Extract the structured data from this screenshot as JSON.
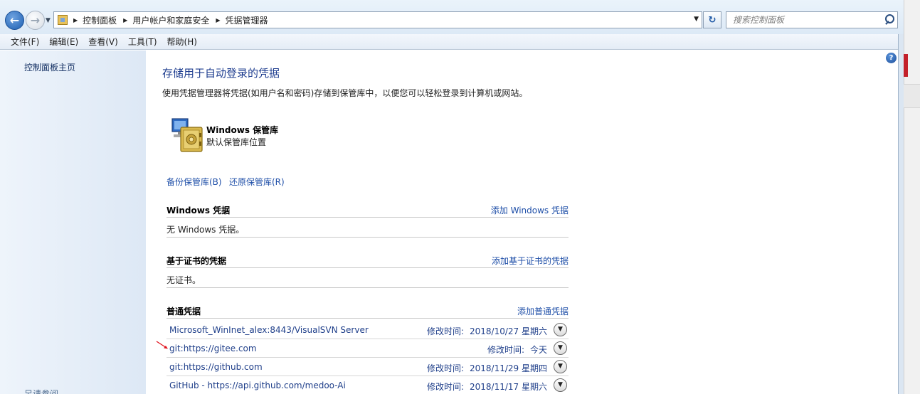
{
  "address_bar": {
    "crumbs": [
      "控制面板",
      "用户帐户和家庭安全",
      "凭据管理器"
    ],
    "search_placeholder": "搜索控制面板"
  },
  "menu": [
    "文件(F)",
    "编辑(E)",
    "查看(V)",
    "工具(T)",
    "帮助(H)"
  ],
  "sidebar": {
    "home_link": "控制面板主页",
    "see_also": "另请参阅"
  },
  "main": {
    "title": "存储用于自动登录的凭据",
    "description": "使用凭据管理器将凭据(如用户名和密码)存储到保管库中，以便您可以轻松登录到计算机或网站。",
    "vault_name": "Windows 保管库",
    "vault_location": "默认保管库位置",
    "backup_link": "备份保管库(B)",
    "restore_link": "还原保管库(R)"
  },
  "sections": {
    "windows": {
      "title": "Windows 凭据",
      "add": "添加 Windows 凭据",
      "empty": "无 Windows 凭据。"
    },
    "cert": {
      "title": "基于证书的凭据",
      "add": "添加基于证书的凭据",
      "empty": "无证书。"
    },
    "generic": {
      "title": "普通凭据",
      "add": "添加普通凭据",
      "items": [
        {
          "name": "Microsoft_WinInet_alex:8443/VisualSVN Server",
          "label": "修改时间:",
          "date": "2018/10/27 星期六"
        },
        {
          "name": "git:https://gitee.com",
          "label": "修改时间:",
          "date": "今天"
        },
        {
          "name": "git:https://github.com",
          "label": "修改时间:",
          "date": "2018/11/29 星期四"
        },
        {
          "name": "GitHub - https://api.github.com/medoo-Ai",
          "label": "修改时间:",
          "date": "2018/11/17 星期六"
        }
      ]
    }
  },
  "icons": {
    "back": "back-arrow-icon",
    "forward": "forward-arrow-icon",
    "refresh": "refresh-icon",
    "search": "search-icon",
    "help": "help-icon",
    "vault": "vault-safe-icon",
    "expand": "chevron-down-icon"
  },
  "colors": {
    "link": "#1f4fa8",
    "title": "#1e3d8f",
    "sidebar_bg": "#dde8f5",
    "annotation_arrow": "#e0101a"
  }
}
